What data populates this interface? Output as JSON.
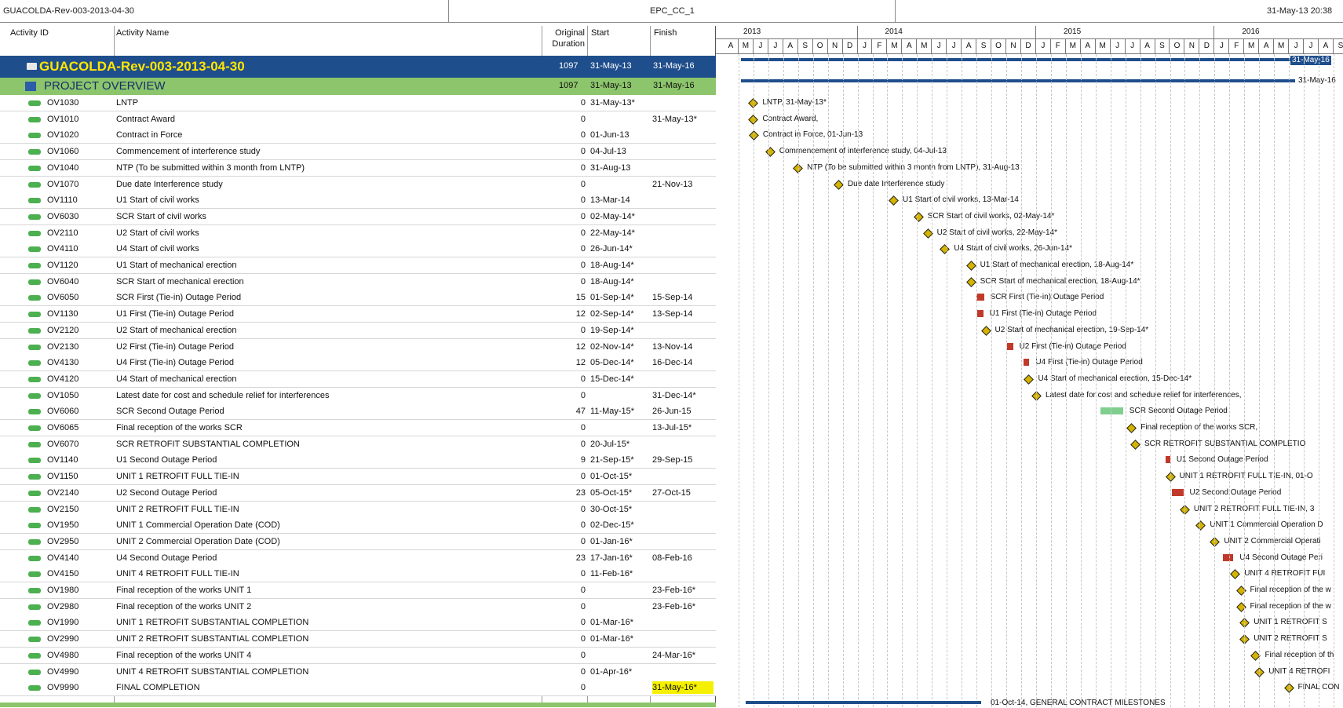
{
  "header": {
    "title": "GUACOLDA-Rev-003-2013-04-30",
    "layout": "EPC_CC_1",
    "timestamp": "31-May-13 20:38"
  },
  "columns": {
    "id": "Activity ID",
    "name": "Activity Name",
    "duration_line1": "Original",
    "duration_line2": "Duration",
    "start": "Start",
    "finish": "Finish"
  },
  "project": {
    "name": "GUACOLDA-Rev-003-2013-04-30",
    "duration": "1097",
    "start": "31-May-13",
    "finish": "31-May-16",
    "bar_label": "31-May-16"
  },
  "wbs": {
    "name": "PROJECT OVERVIEW",
    "duration": "1097",
    "start": "31-May-13",
    "finish": "31-May-16",
    "bar_label": "31-May-16"
  },
  "timeline": {
    "years": [
      "2013",
      "2014",
      "2015",
      "2016"
    ],
    "months": [
      "A",
      "M",
      "J",
      "J",
      "A",
      "S",
      "O",
      "N",
      "D",
      "J",
      "F",
      "M",
      "A",
      "M",
      "J",
      "J",
      "A",
      "S",
      "O",
      "N",
      "D",
      "J",
      "F",
      "M",
      "A",
      "M",
      "J",
      "J",
      "A",
      "S",
      "O",
      "N",
      "D",
      "J",
      "F",
      "M",
      "A",
      "M",
      "J",
      "J",
      "A",
      "S"
    ]
  },
  "activities": [
    {
      "id": "OV1030",
      "name": "LNTP",
      "dur": "0",
      "start": "31-May-13*",
      "finish": "",
      "glabel": "LNTP, 31-May-13*",
      "type": "m",
      "gm": 1.97
    },
    {
      "id": "OV1010",
      "name": "Contract Award",
      "dur": "0",
      "start": "",
      "finish": "31-May-13*",
      "glabel": "Contract Award,",
      "type": "m",
      "gm": 1.97
    },
    {
      "id": "OV1020",
      "name": "Contract in Force",
      "dur": "0",
      "start": "01-Jun-13",
      "finish": "",
      "glabel": "Contract in Force, 01-Jun-13",
      "type": "m",
      "gm": 2.0
    },
    {
      "id": "OV1060",
      "name": "Commencement of interference study",
      "dur": "0",
      "start": "04-Jul-13",
      "finish": "",
      "glabel": "Commencement of interference study, 04-Jul-13",
      "type": "m",
      "gm": 3.1
    },
    {
      "id": "OV1040",
      "name": "NTP (To be submitted within 3 month from LNTP)",
      "dur": "0",
      "start": "31-Aug-13",
      "finish": "",
      "glabel": "NTP (To be submitted within 3 month from LNTP), 31-Aug-13",
      "type": "m",
      "gm": 4.97
    },
    {
      "id": "OV1070",
      "name": "Due date Interference study",
      "dur": "0",
      "start": "",
      "finish": "21-Nov-13",
      "glabel": "Due date Interference study",
      "type": "m",
      "gm": 7.7
    },
    {
      "id": "OV1110",
      "name": "U1 Start of civil works",
      "dur": "0",
      "start": "13-Mar-14",
      "finish": "",
      "glabel": "U1 Start of civil works, 13-Mar-14",
      "type": "m",
      "gm": 11.4
    },
    {
      "id": "OV6030",
      "name": "SCR Start of civil works",
      "dur": "0",
      "start": "02-May-14*",
      "finish": "",
      "glabel": "SCR Start of civil works, 02-May-14*",
      "type": "m",
      "gm": 13.07
    },
    {
      "id": "OV2110",
      "name": "U2 Start of civil works",
      "dur": "0",
      "start": "22-May-14*",
      "finish": "",
      "glabel": "U2 Start of civil works, 22-May-14*",
      "type": "m",
      "gm": 13.7
    },
    {
      "id": "OV4110",
      "name": "U4 Start of civil works",
      "dur": "0",
      "start": "26-Jun-14*",
      "finish": "",
      "glabel": "U4 Start of civil works, 26-Jun-14*",
      "type": "m",
      "gm": 14.85
    },
    {
      "id": "OV1120",
      "name": "U1 Start of mechanical erection",
      "dur": "0",
      "start": "18-Aug-14*",
      "finish": "",
      "glabel": "U1 Start of mechanical erection, 18-Aug-14*",
      "type": "m",
      "gm": 16.6
    },
    {
      "id": "OV6040",
      "name": "SCR Start of mechanical erection",
      "dur": "0",
      "start": "18-Aug-14*",
      "finish": "",
      "glabel": "SCR Start of mechanical erection, 18-Aug-14*",
      "type": "m",
      "gm": 16.6
    },
    {
      "id": "OV6050",
      "name": "SCR First (Tie-in) Outage Period",
      "dur": "15",
      "start": "01-Sep-14*",
      "finish": "15-Sep-14",
      "glabel": "SCR First (Tie-in) Outage Period",
      "type": "b",
      "gm": 17.0,
      "ge": 17.5
    },
    {
      "id": "OV1130",
      "name": "U1 First (Tie-in) Outage Period",
      "dur": "12",
      "start": "02-Sep-14*",
      "finish": "13-Sep-14",
      "glabel": "U1 First (Tie-in) Outage Period",
      "type": "b",
      "gm": 17.05,
      "ge": 17.45
    },
    {
      "id": "OV2120",
      "name": "U2 Start of mechanical erection",
      "dur": "0",
      "start": "19-Sep-14*",
      "finish": "",
      "glabel": "U2 Start of mechanical erection, 19-Sep-14*",
      "type": "m",
      "gm": 17.6
    },
    {
      "id": "OV2130",
      "name": "U2 First (Tie-in) Outage Period",
      "dur": "12",
      "start": "02-Nov-14*",
      "finish": "13-Nov-14",
      "glabel": "U2 First (Tie-in) Outage Period",
      "type": "b",
      "gm": 19.05,
      "ge": 19.45
    },
    {
      "id": "OV4130",
      "name": "U4 First (Tie-in) Outage Period",
      "dur": "12",
      "start": "05-Dec-14*",
      "finish": "16-Dec-14",
      "glabel": "U4 First (Tie-in) Outage Period",
      "type": "b",
      "gm": 20.15,
      "ge": 20.55
    },
    {
      "id": "OV4120",
      "name": "U4 Start of mechanical erection",
      "dur": "0",
      "start": "15-Dec-14*",
      "finish": "",
      "glabel": "U4 Start of mechanical erection, 15-Dec-14*",
      "type": "m",
      "gm": 20.5
    },
    {
      "id": "OV1050",
      "name": "Latest date for cost and schedule relief for interferences",
      "dur": "0",
      "start": "",
      "finish": "31-Dec-14*",
      "glabel": "Latest date for cost and schedule relief for interferences,",
      "type": "m",
      "gm": 21.0
    },
    {
      "id": "OV6060",
      "name": "SCR Second Outage Period",
      "dur": "47",
      "start": "11-May-15*",
      "finish": "26-Jun-15",
      "glabel": "SCR Second Outage Period",
      "type": "g",
      "gm": 25.35,
      "ge": 26.85
    },
    {
      "id": "OV6065",
      "name": "Final reception of the works SCR",
      "dur": "0",
      "start": "",
      "finish": "13-Jul-15*",
      "glabel": "Final reception of the works SCR,",
      "type": "m",
      "gm": 27.4
    },
    {
      "id": "OV6070",
      "name": "SCR RETROFIT SUBSTANTIAL COMPLETION",
      "dur": "0",
      "start": "20-Jul-15*",
      "finish": "",
      "glabel": "SCR RETROFIT SUBSTANTIAL COMPLETIO",
      "type": "m",
      "gm": 27.65
    },
    {
      "id": "OV1140",
      "name": "U1 Second Outage Period",
      "dur": "9",
      "start": "21-Sep-15*",
      "finish": "29-Sep-15",
      "glabel": "U1 Second Outage Period",
      "type": "b",
      "gm": 29.7,
      "ge": 29.97
    },
    {
      "id": "OV1150",
      "name": "UNIT 1 RETROFIT FULL TIE-IN",
      "dur": "0",
      "start": "01-Oct-15*",
      "finish": "",
      "glabel": "UNIT 1 RETROFIT FULL TIE-IN, 01-O",
      "type": "m",
      "gm": 30.0
    },
    {
      "id": "OV2140",
      "name": "U2 Second Outage Period",
      "dur": "23",
      "start": "05-Oct-15*",
      "finish": "27-Oct-15",
      "glabel": "U2 Second Outage Period",
      "type": "b",
      "gm": 30.15,
      "ge": 30.9
    },
    {
      "id": "OV2150",
      "name": "UNIT 2 RETROFIT FULL TIE-IN",
      "dur": "0",
      "start": "30-Oct-15*",
      "finish": "",
      "glabel": "UNIT 2 RETROFIT FULL TIE-IN, 3",
      "type": "m",
      "gm": 30.97
    },
    {
      "id": "OV1950",
      "name": "UNIT 1 Commercial Operation Date (COD)",
      "dur": "0",
      "start": "02-Dec-15*",
      "finish": "",
      "glabel": "UNIT 1 Commercial Operation D",
      "type": "m",
      "gm": 32.05
    },
    {
      "id": "OV2950",
      "name": "UNIT 2 Commercial Operation Date (COD)",
      "dur": "0",
      "start": "01-Jan-16*",
      "finish": "",
      "glabel": "UNIT 2 Commercial Operati",
      "type": "m",
      "gm": 33.0
    },
    {
      "id": "OV4140",
      "name": "U4 Second Outage Period",
      "dur": "23",
      "start": "17-Jan-16*",
      "finish": "08-Feb-16",
      "glabel": "U4 Second Outage Peri",
      "type": "b",
      "gm": 33.55,
      "ge": 34.27
    },
    {
      "id": "OV4150",
      "name": "UNIT 4 RETROFIT FULL TIE-IN",
      "dur": "0",
      "start": "11-Feb-16*",
      "finish": "",
      "glabel": "UNIT 4 RETROFIT FUI",
      "type": "m",
      "gm": 34.37
    },
    {
      "id": "OV1980",
      "name": "Final reception of the works UNIT 1",
      "dur": "0",
      "start": "",
      "finish": "23-Feb-16*",
      "glabel": "Final reception of the w",
      "type": "m",
      "gm": 34.75
    },
    {
      "id": "OV2980",
      "name": "Final reception of the works UNIT 2",
      "dur": "0",
      "start": "",
      "finish": "23-Feb-16*",
      "glabel": "Final reception of the w",
      "type": "m",
      "gm": 34.75
    },
    {
      "id": "OV1990",
      "name": "UNIT 1 RETROFIT SUBSTANTIAL COMPLETION",
      "dur": "0",
      "start": "01-Mar-16*",
      "finish": "",
      "glabel": "UNIT 1 RETROFIT S",
      "type": "m",
      "gm": 35.0
    },
    {
      "id": "OV2990",
      "name": "UNIT 2 RETROFIT SUBSTANTIAL COMPLETION",
      "dur": "0",
      "start": "01-Mar-16*",
      "finish": "",
      "glabel": "UNIT 2 RETROFIT S",
      "type": "m",
      "gm": 35.0
    },
    {
      "id": "OV4980",
      "name": "Final reception of the works UNIT 4",
      "dur": "0",
      "start": "",
      "finish": "24-Mar-16*",
      "glabel": "Final reception of th",
      "type": "m",
      "gm": 35.75
    },
    {
      "id": "OV4990",
      "name": "UNIT 4 RETROFIT SUBSTANTIAL COMPLETION",
      "dur": "0",
      "start": "01-Apr-16*",
      "finish": "",
      "glabel": "UNIT 4 RETROFI",
      "type": "m",
      "gm": 36.0
    },
    {
      "id": "OV9990",
      "name": "FINAL COMPLETION",
      "dur": "0",
      "start": "",
      "finish": "31-May-16*",
      "glabel": "FINAL CON",
      "type": "m",
      "gm": 37.97,
      "highlight": true
    }
  ],
  "footer": {
    "bar_label": "01-Oct-14, GENERAL CONTRACT MILESTONES"
  },
  "colors": {
    "project_band": "#1f4e8c",
    "wbs_band": "#8cc56b",
    "milestone": "#d4b400",
    "critical_bar": "#c0392b",
    "normal_bar": "#7fcf8f",
    "highlight": "#f5f000"
  }
}
